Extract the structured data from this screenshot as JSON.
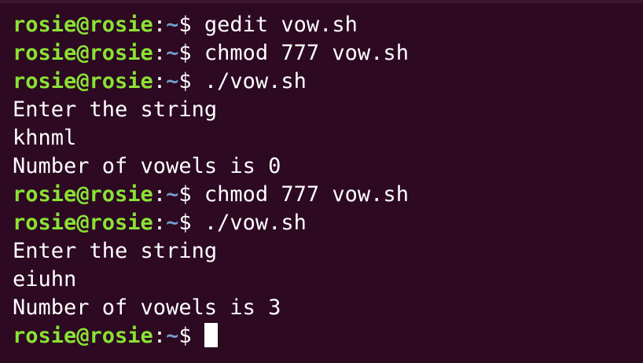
{
  "terminal": {
    "prompt": {
      "user_host": "rosie@rosie",
      "separator": ":",
      "path": "~",
      "symbol": "$ "
    },
    "lines": [
      {
        "type": "prompt",
        "command": "gedit vow.sh"
      },
      {
        "type": "prompt",
        "command": "chmod 777 vow.sh"
      },
      {
        "type": "prompt",
        "command": "./vow.sh"
      },
      {
        "type": "output",
        "text": "Enter the string"
      },
      {
        "type": "output",
        "text": "khnml"
      },
      {
        "type": "output",
        "text": "Number of vowels is 0"
      },
      {
        "type": "prompt",
        "command": "chmod 777 vow.sh"
      },
      {
        "type": "prompt",
        "command": "./vow.sh"
      },
      {
        "type": "output",
        "text": "Enter the string"
      },
      {
        "type": "output",
        "text": "eiuhn"
      },
      {
        "type": "output",
        "text": "Number of vowels is 3"
      },
      {
        "type": "prompt",
        "command": ""
      }
    ]
  },
  "colors": {
    "background": "#2d0922",
    "user_host": "#8ae234",
    "path": "#729fcf",
    "text": "#ffffff"
  }
}
